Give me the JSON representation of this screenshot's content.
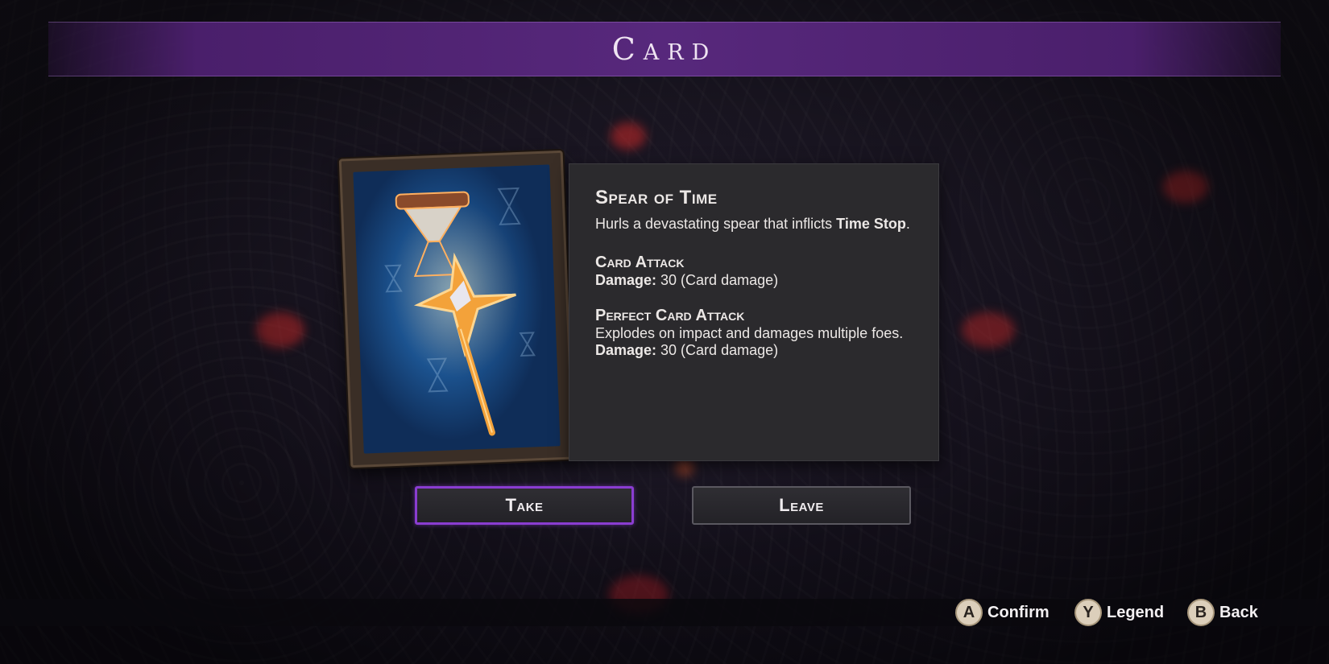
{
  "header": {
    "title": "Card"
  },
  "card": {
    "name": "Spear of Time",
    "description_pre": "Hurls a devastating spear that inflicts ",
    "description_bold": "Time Stop",
    "description_post": ".",
    "attack": {
      "title": "Card Attack",
      "damage_label": "Damage:",
      "damage_value": " 30 (Card damage)"
    },
    "perfect_attack": {
      "title": "Perfect Card Attack",
      "description": "Explodes on impact and damages multiple foes.",
      "damage_label": "Damage:",
      "damage_value": " 30 (Card damage)"
    }
  },
  "buttons": {
    "take": "Take",
    "leave": "Leave"
  },
  "footer": {
    "hints": [
      {
        "key": "A",
        "label": "Confirm"
      },
      {
        "key": "Y",
        "label": "Legend"
      },
      {
        "key": "B",
        "label": "Back"
      }
    ]
  },
  "colors": {
    "accent": "#8a3dd1",
    "title_bar": "#57287c",
    "panel": "#2b2a2d"
  },
  "icons": {
    "card_art": "hourglass-spear-icon"
  }
}
